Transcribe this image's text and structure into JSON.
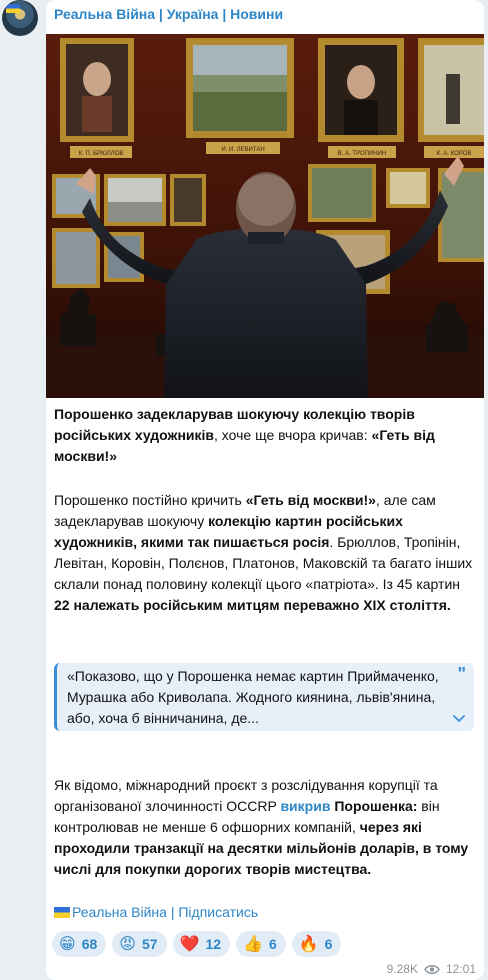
{
  "channel": {
    "name": "Реальна Війна | Україна | Новини"
  },
  "post": {
    "intro": {
      "part1": "Порошенко задекларував шокуючу колекцію творів російських художників",
      "part2": ", хоче ще вчора кричав: ",
      "part3": "«Геть від москви!»"
    },
    "body": {
      "p1": "Порошенко постійно кричить ",
      "p2": "«Геть від москви!»",
      "p3": ", але сам задекларував шокуючу ",
      "p4": "колекцію картин російських художників, якими так пишається росія",
      "p5": ". Брюллов, Тропінін, Левітан, Коровін, Полєнов, Платонов, Маковскій та багато інших склали понад половину колекції цього «патріота». Із 45 картин ",
      "p6": "22 належать російським митцям переважно XIX століття."
    },
    "quote": {
      "text": "«Показово, що у Порошенка немає картин Приймаченко, Мурашка або Криволапа. Жодного киянина, львів'янина, або, хоча б вінничанина, де...",
      "mark": "\"",
      "icon": "chevron-down-icon"
    },
    "occrp": {
      "p1": "Як відомо, міжнародний проєкт з розслідування корупції та організованої злочинності OCCRP ",
      "link": "викрив",
      "p2": " ",
      "p3": "Порошенка:",
      "p4": " він контролював не менше 6 офшорних компаній, ",
      "p5": "через які проходили транзакції на десятки мільйонів доларів, в тому числі для покупки дорогих творів мистецтва."
    },
    "footer_link": "Реальна Війна | Підписатись"
  },
  "photo": {
    "plaques": [
      "К. П. БРЮЛЛОВ",
      "И. И. ЛЕВИТАН",
      "В. А. ТРОПИНИН",
      "К. А. КОРОВ"
    ]
  },
  "reactions": [
    {
      "emoji": "😁",
      "count": "68"
    },
    {
      "emoji": "😡",
      "count": "57"
    },
    {
      "emoji": "❤️",
      "count": "12"
    },
    {
      "emoji": "👍",
      "count": "6"
    },
    {
      "emoji": "🔥",
      "count": "6"
    }
  ],
  "meta": {
    "views": "9.28K",
    "time": "12:01",
    "views_icon": "eye-icon"
  },
  "colors": {
    "accent": "#2e86c7",
    "background": "#e9eef2",
    "quote_bg": "#e7f0f9"
  }
}
